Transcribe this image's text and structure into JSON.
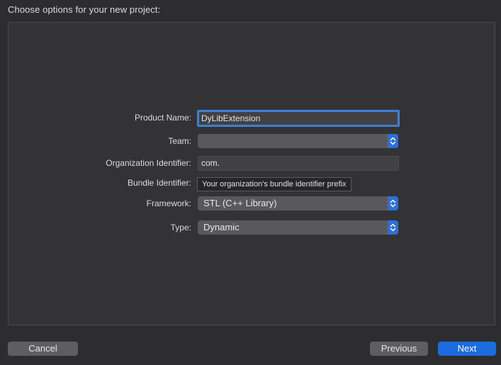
{
  "header": {
    "title": "Choose options for your new project:"
  },
  "form": {
    "product_name": {
      "label": "Product Name:",
      "value": "DyLibExtension"
    },
    "team": {
      "label": "Team:",
      "value": ""
    },
    "organization_identifier": {
      "label": "Organization Identifier:",
      "value": "com."
    },
    "bundle_identifier": {
      "label": "Bundle Identifier:",
      "tooltip": "Your organization's bundle identifier prefix"
    },
    "framework": {
      "label": "Framework:",
      "value": "STL (C++ Library)"
    },
    "type": {
      "label": "Type:",
      "value": "Dynamic"
    }
  },
  "footer": {
    "cancel_label": "Cancel",
    "previous_label": "Previous",
    "next_label": "Next"
  },
  "colors": {
    "accent": "#1a6cdf",
    "focus_ring": "#3f7fd3",
    "background": "#2d2d2f"
  },
  "icons": {
    "popup_stepper": "chevron-up-down-icon"
  }
}
